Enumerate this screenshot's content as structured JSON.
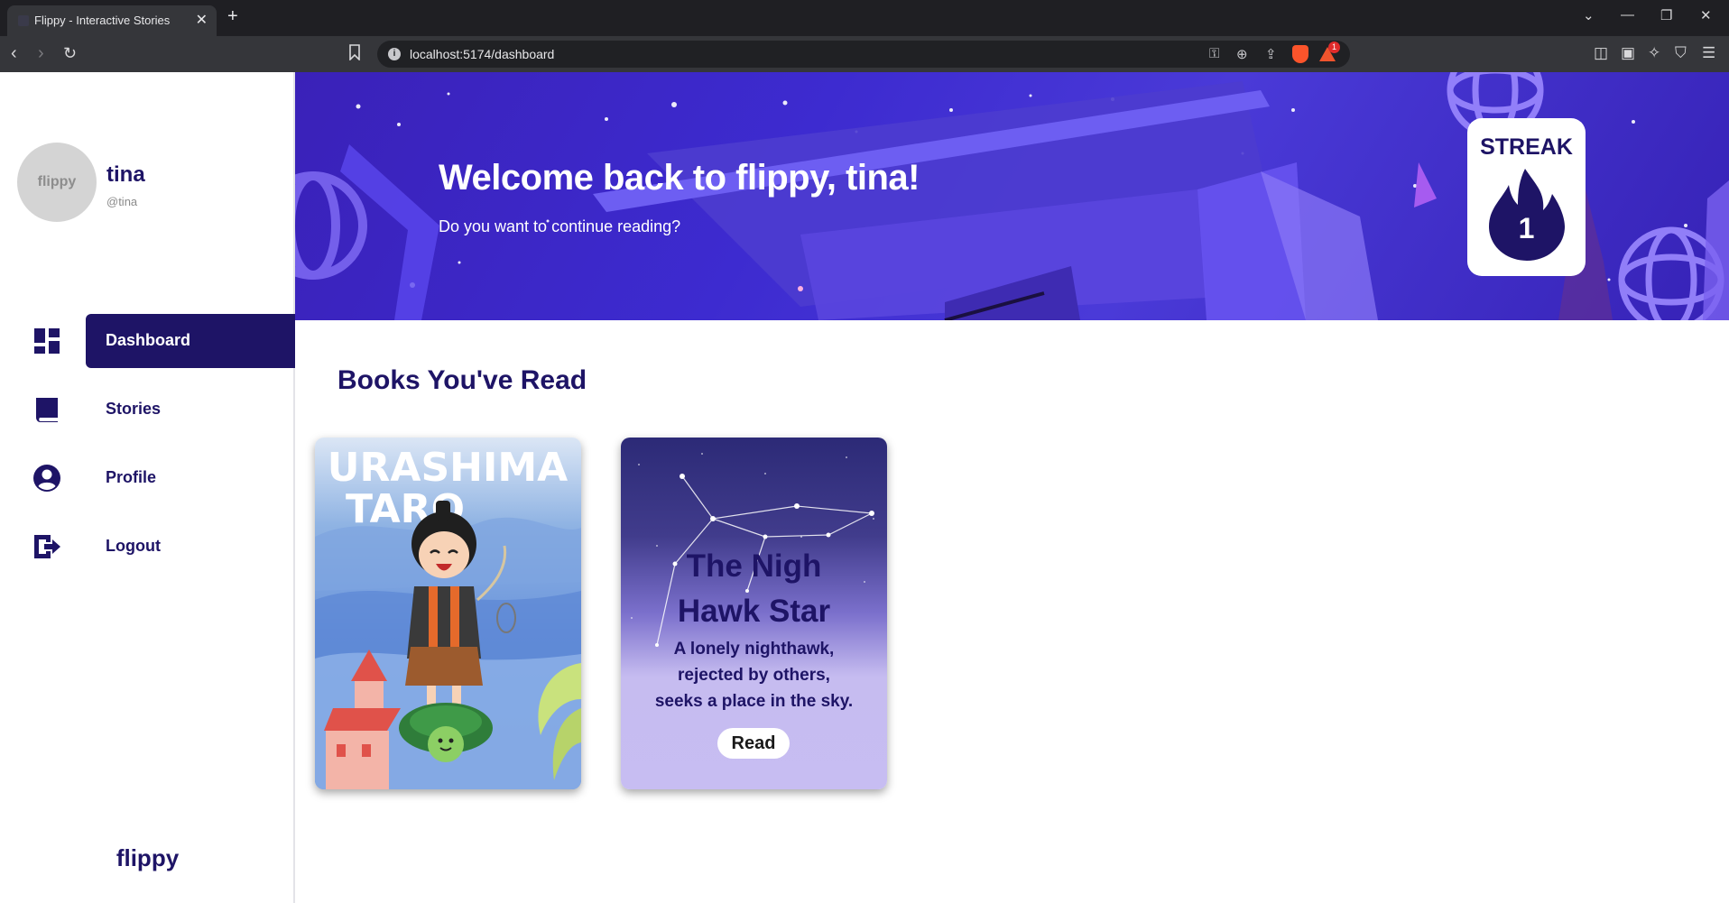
{
  "browser": {
    "tab_title": "Flippy - Interactive Stories",
    "tab_close": "✕",
    "new_tab": "+",
    "url": "localhost:5174/dashboard",
    "rewards_badge": "1"
  },
  "user": {
    "avatar_text": "flippy",
    "name": "tina",
    "handle": "@tina"
  },
  "sidebar": {
    "items": [
      {
        "label": "Dashboard",
        "icon": "dashboard-icon"
      },
      {
        "label": "Stories",
        "icon": "book-icon"
      },
      {
        "label": "Profile",
        "icon": "account-circle-icon"
      },
      {
        "label": "Logout",
        "icon": "logout-icon"
      }
    ],
    "brand": "flippy"
  },
  "banner": {
    "welcome": "Welcome back to flippy, tina!",
    "subtitle": "Do you want to continue reading?"
  },
  "streak": {
    "label": "STREAK",
    "count": "1"
  },
  "books_section": {
    "title": "Books You've Read",
    "books": [
      {
        "cover_text": "URASHIMA TARO"
      },
      {
        "title_line1": "The Nigh",
        "title_line2": "Hawk Star",
        "desc_line1": "A lonely nighthawk,",
        "desc_line2": "rejected by others,",
        "desc_line3": "seeks a place in the sky.",
        "read_label": "Read"
      }
    ]
  },
  "colors": {
    "primary": "#1e1466",
    "banner": "#3d2bd0",
    "card_lavender": "#c7bdf2"
  }
}
